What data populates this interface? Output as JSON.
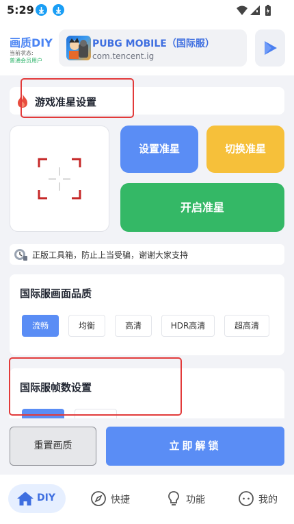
{
  "status_bar": {
    "time": "5:29"
  },
  "header": {
    "brand": "画质DIY",
    "status_label": "当前状态:",
    "status_value": "普通会员用户",
    "game_name": "PUBG MOBILE（国际服）",
    "game_package": "com.tencent.ig"
  },
  "crosshair": {
    "section_title": "游戏准星设置",
    "set_label": "设置准星",
    "switch_label": "切换准星",
    "enable_label": "开启准星"
  },
  "notice": {
    "text": "正版工具箱，防止上当受骗，谢谢大家支持"
  },
  "quality": {
    "title": "国际服画面品质",
    "options": [
      "流畅",
      "均衡",
      "高清",
      "HDR高清",
      "超高清"
    ],
    "selected": "流畅"
  },
  "fps": {
    "title": "国际服帧数设置"
  },
  "actions": {
    "reset_label": "重置画质",
    "unlock_label": "立即解锁"
  },
  "nav": {
    "items": [
      {
        "label": "DIY",
        "icon": "home-icon",
        "active": true
      },
      {
        "label": "快捷",
        "icon": "compass-icon",
        "active": false
      },
      {
        "label": "功能",
        "icon": "lightbulb-icon",
        "active": false
      },
      {
        "label": "我的",
        "icon": "chat-icon",
        "active": false
      }
    ]
  },
  "colors": {
    "accent": "#5a8df5",
    "yellow": "#f6c03a",
    "green": "#34b866",
    "highlight": "#e23a3a"
  }
}
